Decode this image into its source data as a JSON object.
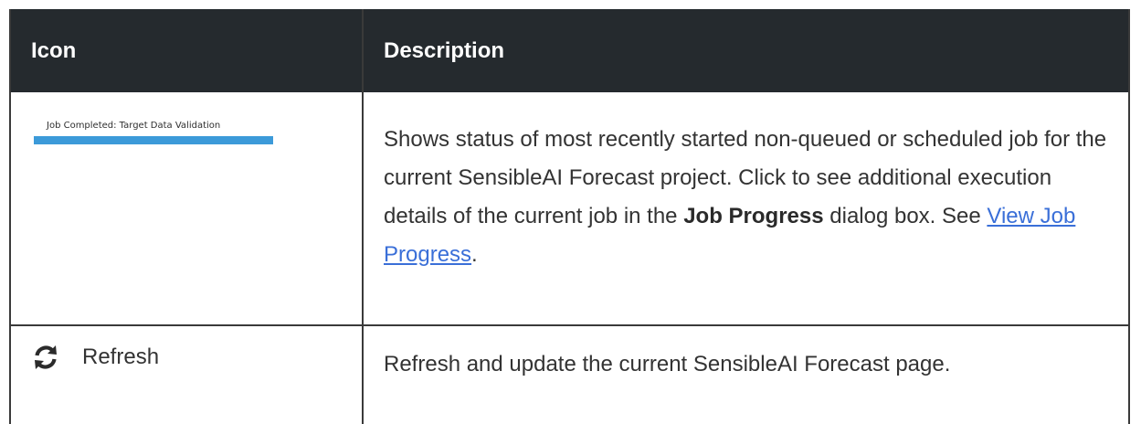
{
  "header": {
    "col_icon": "Icon",
    "col_description": "Description"
  },
  "rows": {
    "job": {
      "thumbnail_text": "Job Completed: Target Data Validation",
      "progress": 1.0,
      "description_part1": "Shows status of most recently started non-queued or scheduled job for the current SensibleAI Forecast project. Click to see additional execution details of the current job in the ",
      "bold1": "Job Progress",
      "description_part2": " dialog box. See ",
      "link": "View Job Progress",
      "description_end": "."
    },
    "refresh": {
      "icon": "refresh-icon",
      "label": "Refresh",
      "description": "Refresh and update the current SensibleAI Forecast page."
    }
  },
  "colors": {
    "header_bg": "#252a2e",
    "progress_bar": "#3c9ad9",
    "link": "#3a6fd8"
  }
}
